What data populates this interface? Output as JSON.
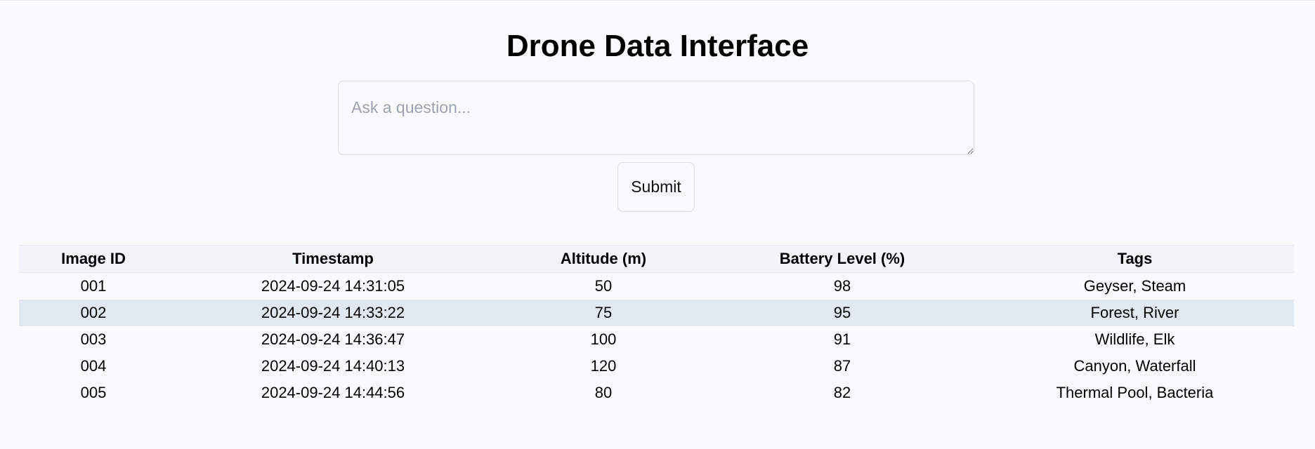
{
  "header": {
    "title": "Drone Data Interface"
  },
  "query": {
    "placeholder": "Ask a question...",
    "value": "",
    "submit_label": "Submit"
  },
  "table": {
    "columns": [
      "Image ID",
      "Timestamp",
      "Altitude (m)",
      "Battery Level (%)",
      "Tags"
    ],
    "rows": [
      [
        "001",
        "2024-09-24 14:31:05",
        "50",
        "98",
        "Geyser, Steam"
      ],
      [
        "002",
        "2024-09-24 14:33:22",
        "75",
        "95",
        "Forest, River"
      ],
      [
        "003",
        "2024-09-24 14:36:47",
        "100",
        "91",
        "Wildlife, Elk"
      ],
      [
        "004",
        "2024-09-24 14:40:13",
        "120",
        "87",
        "Canyon, Waterfall"
      ],
      [
        "005",
        "2024-09-24 14:44:56",
        "80",
        "82",
        "Thermal Pool, Bacteria"
      ]
    ]
  },
  "colors": {
    "background": "#f8fafc",
    "header_row": "#f1f5f9",
    "alt_row": "#e2e8f0",
    "border": "#d9dee5"
  }
}
